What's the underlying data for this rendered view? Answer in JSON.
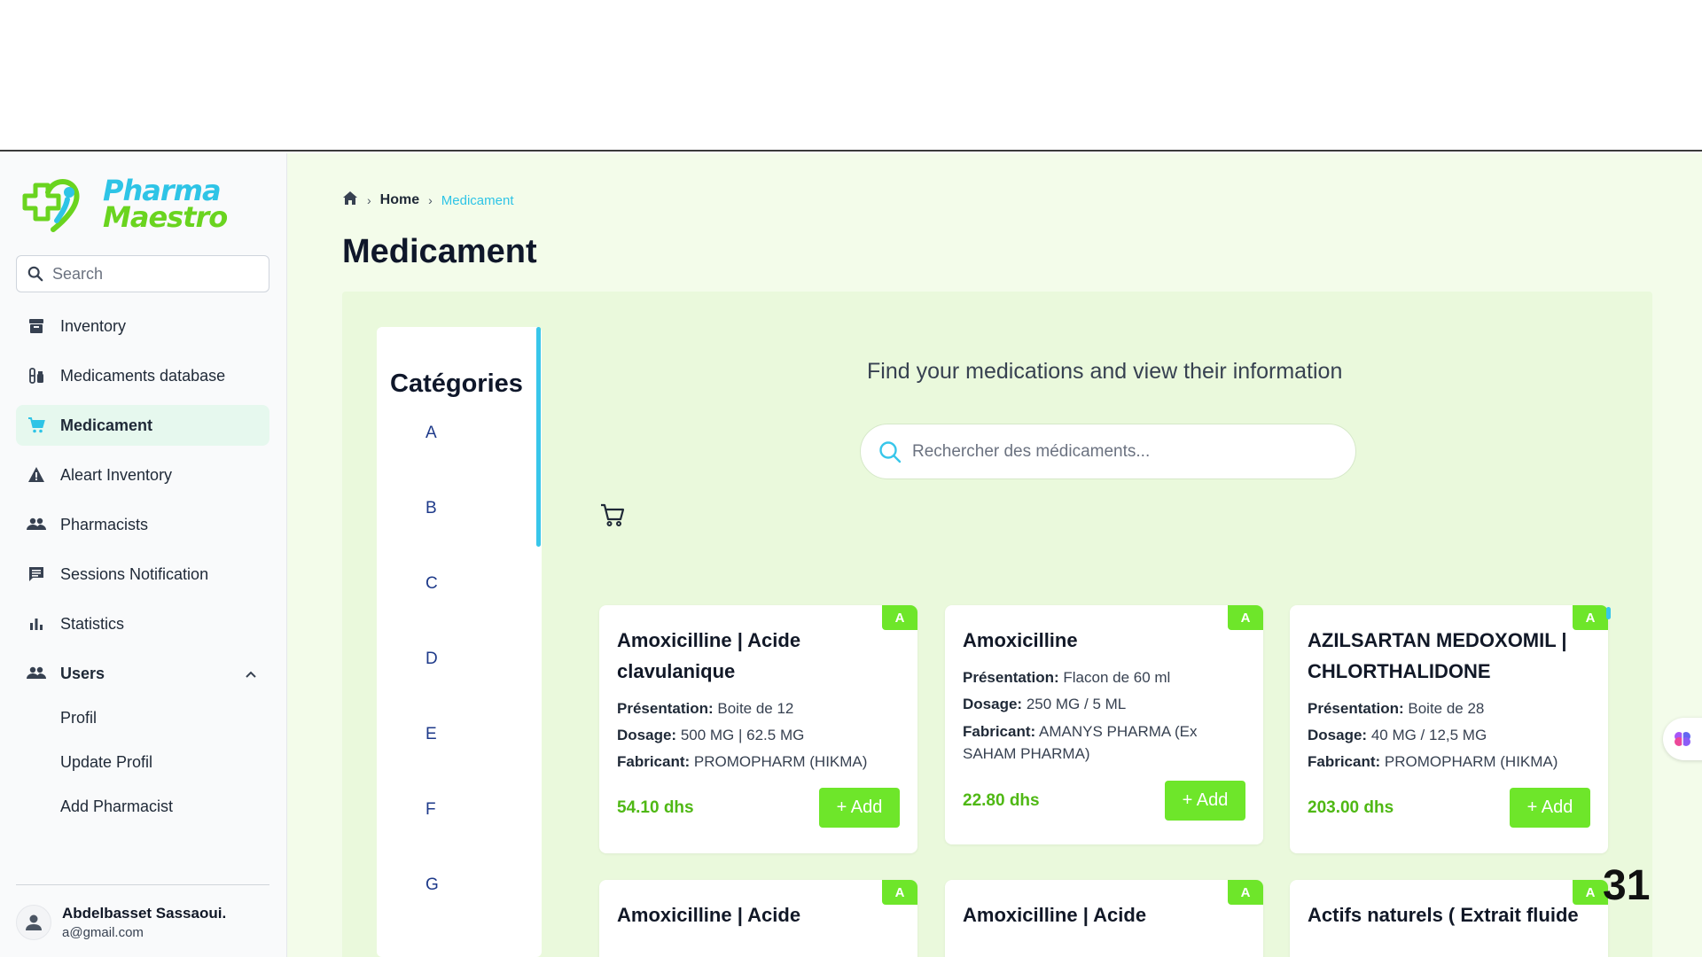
{
  "app": {
    "logo_line1": "Pharma",
    "logo_line2": "Maestro",
    "brand_colors": {
      "blue": "#2ec4e6",
      "green": "#6ad41f"
    }
  },
  "sidebar": {
    "search_placeholder": "Search",
    "items": [
      {
        "label": "Inventory",
        "icon": "archive-box-icon",
        "active": false
      },
      {
        "label": "Medicaments database",
        "icon": "pills-icon",
        "active": false
      },
      {
        "label": "Medicament",
        "icon": "shopping-cart-icon",
        "active": true
      },
      {
        "label": "Aleart Inventory",
        "icon": "warning-icon",
        "active": false
      },
      {
        "label": "Pharmacists",
        "icon": "people-icon",
        "active": false
      },
      {
        "label": "Sessions Notification",
        "icon": "chat-icon",
        "active": false
      },
      {
        "label": "Statistics",
        "icon": "bar-chart-icon",
        "active": false
      }
    ],
    "users": {
      "label": "Users",
      "icon": "people-icon",
      "expanded": true,
      "sub_items": [
        "Profil",
        "Update Profil",
        "Add Pharmacist"
      ]
    },
    "user": {
      "name": "Abdelbasset Sassaoui.",
      "email": "a@gmail.com"
    }
  },
  "breadcrumb": {
    "home": "Home",
    "current": "Medicament"
  },
  "page_title": "Medicament",
  "categories": {
    "title": "Catégories",
    "letters": [
      "A",
      "B",
      "C",
      "D",
      "E",
      "F",
      "G"
    ]
  },
  "main": {
    "find_text": "Find your medications and view their information",
    "search_placeholder": "Rechercher des médicaments..."
  },
  "labels": {
    "presentation": "Présentation:",
    "dosage": "Dosage:",
    "fabricant": "Fabricant:",
    "add": "+ Add"
  },
  "cards": [
    {
      "badge": "A",
      "name": "Amoxicilline | Acide clavulanique",
      "presentation": "Boite de 12",
      "dosage": "500 MG  | 62.5 MG",
      "fabricant": "PROMOPHARM (HIKMA)",
      "price": "54.10 dhs"
    },
    {
      "badge": "A",
      "name": "Amoxicilline",
      "presentation": "Flacon de 60 ml",
      "dosage": "250 MG / 5 ML",
      "fabricant": "AMANYS PHARMA (Ex SAHAM PHARMA)",
      "price": "22.80 dhs"
    },
    {
      "badge": "A",
      "name": "AZILSARTAN MEDOXOMIL | CHLORTHALIDONE",
      "presentation": "Boite de 28",
      "dosage": "40 MG / 12,5 MG",
      "fabricant": "PROMOPHARM (HIKMA)",
      "price": "203.00 dhs"
    },
    {
      "badge": "A",
      "name": "Amoxicilline | Acide"
    },
    {
      "badge": "A",
      "name": "Amoxicilline | Acide"
    },
    {
      "badge": "A",
      "name": "Actifs naturels ( Extrait fluide"
    }
  ],
  "page_number": "31",
  "accent_green": "#6ee62a",
  "accent_blue": "#2ec4e6"
}
